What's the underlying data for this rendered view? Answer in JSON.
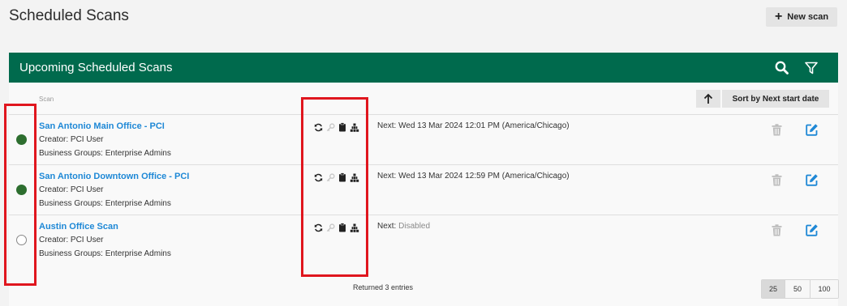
{
  "page": {
    "title": "Scheduled Scans",
    "new_scan_label": "New scan",
    "new_scan_icon": "plus-icon"
  },
  "panel": {
    "title": "Upcoming Scheduled Scans",
    "header_color": "#006a4d",
    "header_icons": [
      "search-icon",
      "filter-icon"
    ],
    "column_scan": "Scan",
    "sort_direction_icon": "arrow-up-icon",
    "sort_label": "Sort by Next start date"
  },
  "rows": [
    {
      "status": "enabled",
      "name": "San Antonio Main Office - PCI",
      "creator": "Creator: PCI User",
      "groups": "Business Groups: Enterprise Admins",
      "next_prefix": "Next:",
      "next_value": "Wed 13 Mar 2024 12:01 PM (America/Chicago)",
      "icons": [
        "refresh-icon",
        "key-icon",
        "clipboard-icon",
        "network-icon"
      ]
    },
    {
      "status": "enabled",
      "name": "San Antonio Downtown Office - PCI",
      "creator": "Creator: PCI User",
      "groups": "Business Groups: Enterprise Admins",
      "next_prefix": "Next:",
      "next_value": "Wed 13 Mar 2024 12:59 PM (America/Chicago)",
      "icons": [
        "refresh-icon",
        "key-icon",
        "clipboard-icon",
        "network-icon"
      ]
    },
    {
      "status": "disabled",
      "name": "Austin Office Scan",
      "creator": "Creator: PCI User",
      "groups": "Business Groups: Enterprise Admins",
      "next_prefix": "Next:",
      "next_value": "Disabled",
      "icons": [
        "refresh-icon",
        "key-icon",
        "clipboard-icon",
        "network-icon"
      ]
    }
  ],
  "footer": {
    "returned": "Returned 3 entries",
    "page_sizes": [
      "25",
      "50",
      "100"
    ],
    "active_page_size": "25"
  },
  "colors": {
    "link": "#1e88d6",
    "status_on": "#2d6e2f",
    "highlight": "#e0161e",
    "edit_icon": "#1e88d6"
  }
}
